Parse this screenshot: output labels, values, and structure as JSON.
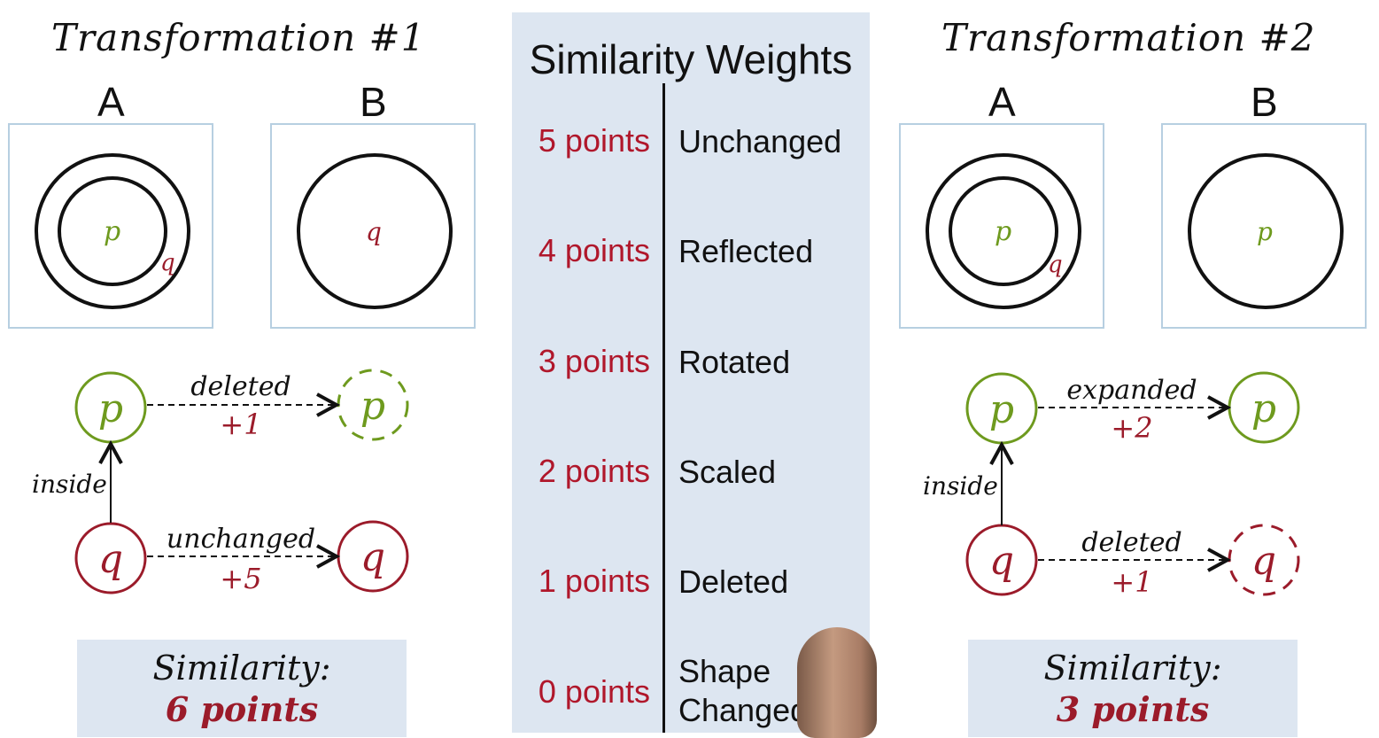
{
  "left": {
    "title": "Transformation #1",
    "label_a": "A",
    "label_b": "B",
    "frame_a": {
      "outer_label": "q",
      "inner_label": "p"
    },
    "frame_b": {
      "label": "q"
    },
    "graph": {
      "node_p": "p",
      "node_q": "q",
      "node_p_result": "p",
      "node_q_result": "q",
      "relation": "inside",
      "edge_p_label": "deleted",
      "edge_p_score": "+1",
      "edge_q_label": "unchanged",
      "edge_q_score": "+5"
    },
    "similarity_label": "Similarity:",
    "similarity_value": "6 points"
  },
  "right": {
    "title": "Transformation #2",
    "label_a": "A",
    "label_b": "B",
    "frame_a": {
      "outer_label": "q",
      "inner_label": "p"
    },
    "frame_b": {
      "label": "p"
    },
    "graph": {
      "node_p": "p",
      "node_q": "q",
      "node_p_result": "p",
      "node_q_result": "q",
      "relation": "inside",
      "edge_p_label": "expanded",
      "edge_p_score": "+2",
      "edge_q_label": "deleted",
      "edge_q_score": "+1"
    },
    "similarity_label": "Similarity:",
    "similarity_value": "3 points"
  },
  "weights": {
    "title": "Similarity Weights",
    "rows": [
      {
        "points": "5 points",
        "label": "Unchanged"
      },
      {
        "points": "4 points",
        "label": "Reflected"
      },
      {
        "points": "3 points",
        "label": "Rotated"
      },
      {
        "points": "2 points",
        "label": "Scaled"
      },
      {
        "points": "1 points",
        "label": "Deleted"
      },
      {
        "points": "0 points",
        "label_line1": "Shape",
        "label_line2": "Changed"
      }
    ]
  },
  "colors": {
    "green": "#6e9a1e",
    "red": "#9b1b2a",
    "panel": "#dde6f1",
    "frame_border": "#b7cfe1"
  }
}
